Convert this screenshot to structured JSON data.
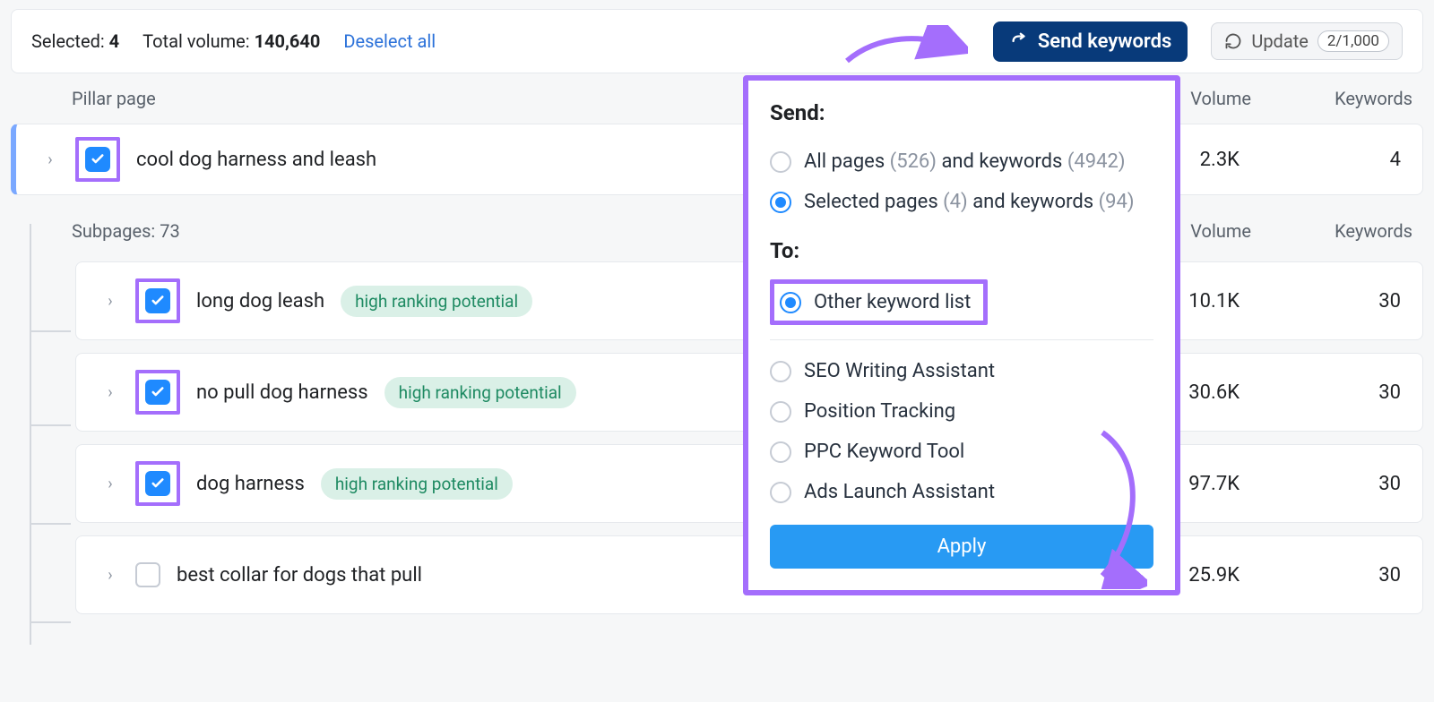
{
  "summary": {
    "selected_label": "Selected:",
    "selected_count": "4",
    "total_volume_label": "Total volume:",
    "total_volume": "140,640",
    "deselect": "Deselect all",
    "send_button": "Send keywords",
    "update_button": "Update",
    "update_count": "2/1,000"
  },
  "columns": {
    "pillar": "Pillar page",
    "volume": "Volume",
    "keywords": "Keywords"
  },
  "pillar": {
    "title": "cool dog harness and leash",
    "volume": "2.3K",
    "keywords": "4",
    "checked": true
  },
  "subpages_header": {
    "label_prefix": "Subpages:",
    "count": "73",
    "volume": "Volume",
    "keywords": "Keywords"
  },
  "subpages": [
    {
      "title": "long dog leash",
      "badge": "high ranking potential",
      "volume": "10.1K",
      "keywords": "30",
      "checked": true,
      "highlight": true
    },
    {
      "title": "no pull dog harness",
      "badge": "high ranking potential",
      "volume": "30.6K",
      "keywords": "30",
      "checked": true,
      "highlight": true
    },
    {
      "title": "dog harness",
      "badge": "high ranking potential",
      "volume": "97.7K",
      "keywords": "30",
      "checked": true,
      "highlight": true
    },
    {
      "title": "best collar for dogs that pull",
      "badge": "",
      "volume": "25.9K",
      "keywords": "30",
      "checked": false,
      "highlight": false
    }
  ],
  "popover": {
    "send_heading": "Send:",
    "all_pages_label_a": "All pages",
    "all_pages_count_a": "(526)",
    "all_pages_mid": "and keywords",
    "all_pages_count_b": "(4942)",
    "selected_pages_label_a": "Selected pages",
    "selected_pages_count_a": "(4)",
    "selected_pages_count_b": "(94)",
    "to_heading": "To:",
    "other_keyword_list": "Other keyword list",
    "tools": [
      "SEO Writing Assistant",
      "Position Tracking",
      "PPC Keyword Tool",
      "Ads Launch Assistant"
    ],
    "apply": "Apply"
  }
}
